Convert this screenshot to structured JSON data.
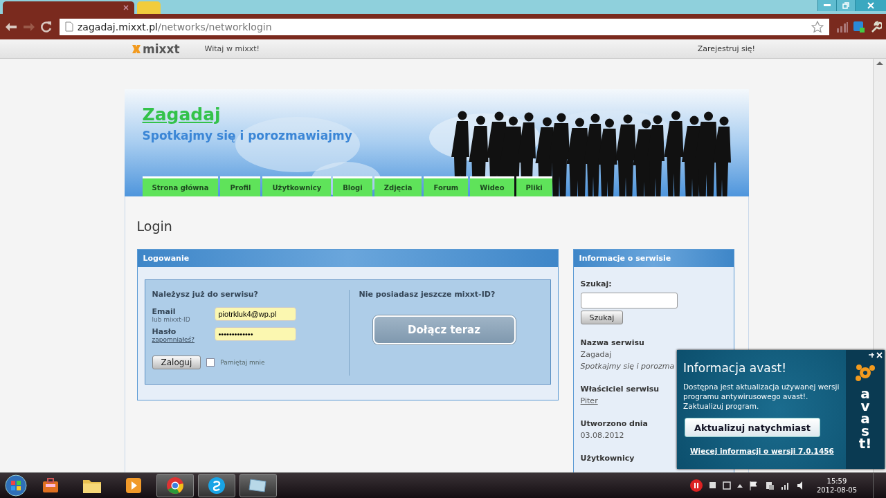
{
  "browser": {
    "tabs": [
      {
        "kind": "page",
        "selected": true
      },
      {
        "kind": "new",
        "selected": false
      }
    ],
    "url_host": "zagadaj.mixxt.pl",
    "url_path": "/networks/networklogin"
  },
  "topbar": {
    "logo": "mixxt",
    "welcome": "Witaj w mixxt!",
    "register": "Zarejestruj się!"
  },
  "banner": {
    "title": "Zagadaj",
    "subtitle": "Spotkajmy się i porozmawiajmy"
  },
  "nav": [
    {
      "label": "Strona główna"
    },
    {
      "label": "Profil"
    },
    {
      "label": "Użytkownicy"
    },
    {
      "label": "Blogi"
    },
    {
      "label": "Zdjęcia"
    },
    {
      "label": "Forum"
    },
    {
      "label": "Wideo"
    },
    {
      "label": "Pliki"
    }
  ],
  "page_title": "Login",
  "login": {
    "header": "Logowanie",
    "question": "Należysz już do serwisu?",
    "email_label": "Email",
    "email_hint": "lub mixxt-ID",
    "email_value": "piotrkluk4@wp.pl",
    "password_label": "Hasło",
    "forgot_link": "zapomniałeś?",
    "password_value": "•••••••••••••",
    "submit": "Zaloguj",
    "remember": {
      "label": "Pamiętaj mnie",
      "checked": false
    },
    "signup_question": "Nie posiadasz jeszcze mixxt-ID?",
    "join_button": "Dołącz teraz"
  },
  "info": {
    "header": "Informacje o serwisie",
    "search_label": "Szukaj:",
    "search_button": "Szukaj",
    "sections": [
      {
        "label": "Nazwa serwisu",
        "lines": [
          {
            "kind": "plain",
            "text": "Zagadaj"
          },
          {
            "kind": "italic",
            "text": "Spotkajmy się i porozma"
          }
        ]
      },
      {
        "label": "Właściciel serwisu",
        "lines": [
          {
            "kind": "link",
            "text": "Piter"
          }
        ]
      },
      {
        "label": "Utworzono dnia",
        "lines": [
          {
            "kind": "plain",
            "text": "03.08.2012"
          }
        ]
      },
      {
        "label": "Użytkownicy"
      }
    ]
  },
  "popup": {
    "title": "Informacja avast!",
    "body": "Dostępna jest aktualizacja używanej wersji programu antywirusowego avast!. Zaktualizuj program.",
    "button": "Aktualizuj natychmiast",
    "link": "Wiecej informacji o wersji 7.0.1456",
    "brand": "avast!"
  },
  "taskbar": {
    "items": [
      {
        "kind": "toolbox",
        "running": false
      },
      {
        "kind": "folder",
        "running": false
      },
      {
        "kind": "media",
        "running": false
      },
      {
        "kind": "browser",
        "running": true
      },
      {
        "kind": "chat",
        "running": true
      },
      {
        "kind": "window",
        "running": true
      }
    ],
    "time": "15:59",
    "date": "2012-08-05"
  }
}
